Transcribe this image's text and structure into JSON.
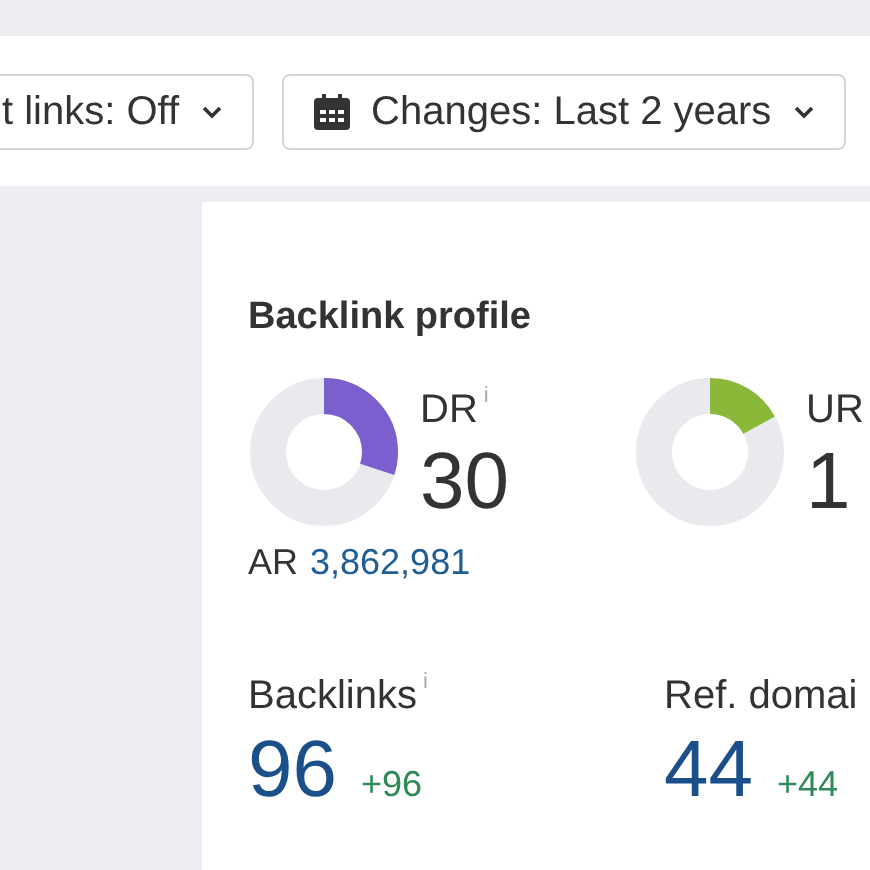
{
  "toolbar": {
    "filters": [
      {
        "label": "t links: Off",
        "kind": "plain"
      },
      {
        "label": "Changes: Last 2 years",
        "kind": "calendar"
      }
    ]
  },
  "backlink_profile": {
    "title": "Backlink profile",
    "ratings": [
      {
        "label": "DR",
        "info": "i",
        "value": "30",
        "level": 0.3,
        "color": "#7b5fcf"
      },
      {
        "label": "UR",
        "value": "1",
        "level": 0.17,
        "color": "#8cb83a"
      }
    ],
    "ar": {
      "label": "AR",
      "value": "3,862,981"
    },
    "metrics": [
      {
        "label": "Backlinks",
        "info": "i",
        "value": "96",
        "change": "+96"
      },
      {
        "label": "Ref. domai",
        "value": "44",
        "change": "+44"
      }
    ]
  }
}
